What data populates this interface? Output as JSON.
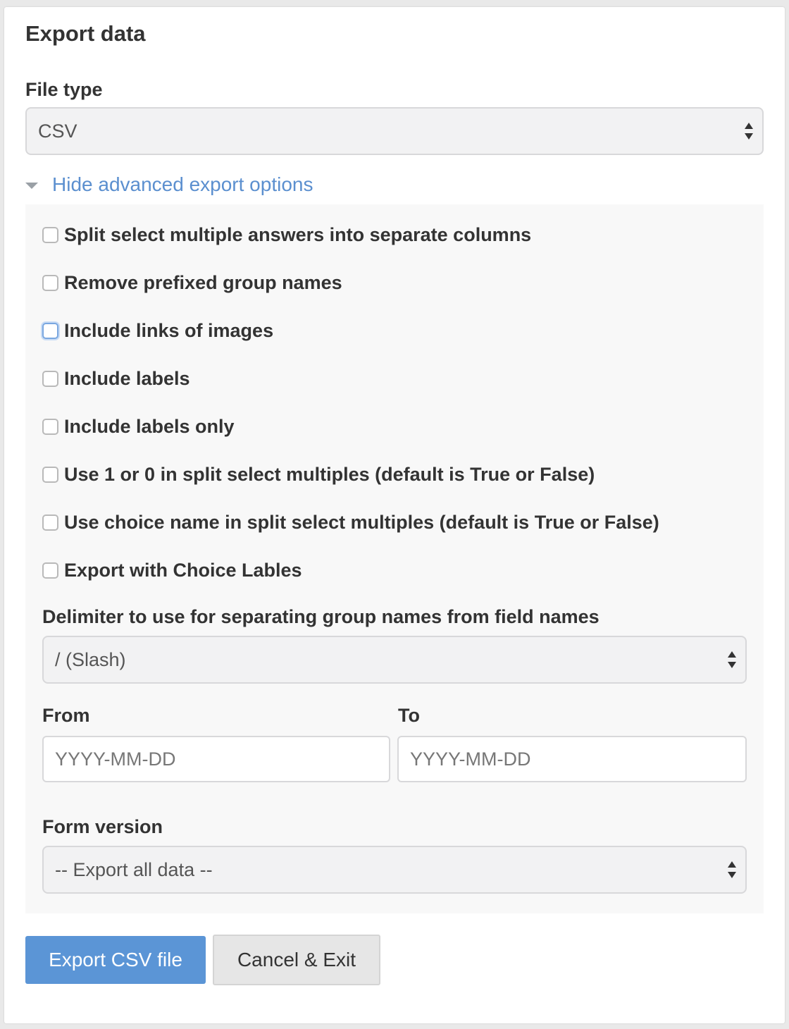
{
  "header": {
    "title": "Export data"
  },
  "file_type": {
    "label": "File type",
    "selected": "CSV"
  },
  "advanced_toggle": {
    "label": "Hide advanced export options"
  },
  "options": [
    {
      "label": "Split select multiple answers into separate columns",
      "checked": false
    },
    {
      "label": "Remove prefixed group names",
      "checked": false
    },
    {
      "label": "Include links of images",
      "checked": false,
      "focused": true
    },
    {
      "label": "Include labels",
      "checked": false
    },
    {
      "label": "Include labels only",
      "checked": false
    },
    {
      "label": "Use 1 or 0 in split select multiples (default is True or False)",
      "checked": false
    },
    {
      "label": "Use choice name in split select multiples (default is True or False)",
      "checked": false
    },
    {
      "label": "Export with Choice Lables",
      "checked": false
    }
  ],
  "delimiter": {
    "label": "Delimiter to use for separating group names from field names",
    "selected": "/ (Slash)"
  },
  "date_range": {
    "from_label": "From",
    "from_placeholder": "YYYY-MM-DD",
    "to_label": "To",
    "to_placeholder": "YYYY-MM-DD"
  },
  "form_version": {
    "label": "Form version",
    "selected": "-- Export all data --"
  },
  "actions": {
    "export_label": "Export CSV file",
    "cancel_label": "Cancel & Exit"
  },
  "colors": {
    "link": "#5b8fcf",
    "primary_button": "#5b95d6",
    "focus_ring": "#7aa7e0"
  }
}
